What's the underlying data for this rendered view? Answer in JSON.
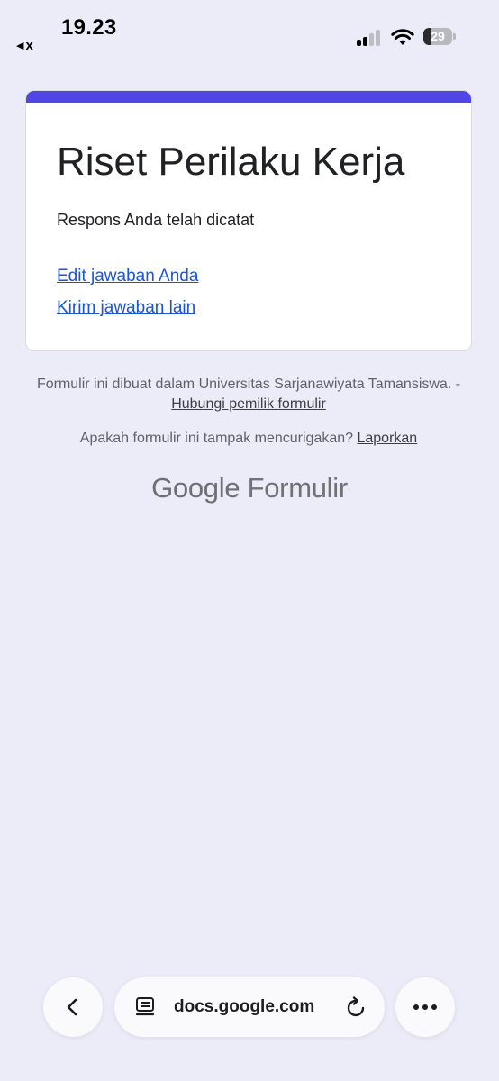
{
  "status_bar": {
    "back_app_label": "x",
    "time": "19.23",
    "battery_level": "29"
  },
  "card": {
    "title": "Riset Perilaku Kerja",
    "message": "Respons Anda telah dicatat",
    "edit_link": "Edit jawaban Anda",
    "another_link": "Kirim jawaban lain"
  },
  "footer": {
    "created_in": "Formulir ini dibuat dalam Universitas Sarjanawiyata Tamansiswa. - ",
    "contact_owner": "Hubungi pemilik formulir",
    "suspicious": "Apakah formulir ini tampak mencurigakan? ",
    "report": "Laporkan"
  },
  "brand": {
    "google": "Google",
    "product": "Formulir"
  },
  "browser_bar": {
    "url": "docs.google.com"
  },
  "colors": {
    "background": "#ecebf8",
    "accent": "#4f46e5",
    "link": "#1a55d8"
  },
  "icons": [
    "back-triangle-icon",
    "signal-icon",
    "wifi-icon",
    "battery-icon",
    "chevron-left-icon",
    "page-layout-icon",
    "reload-icon",
    "more-horizontal-icon"
  ]
}
